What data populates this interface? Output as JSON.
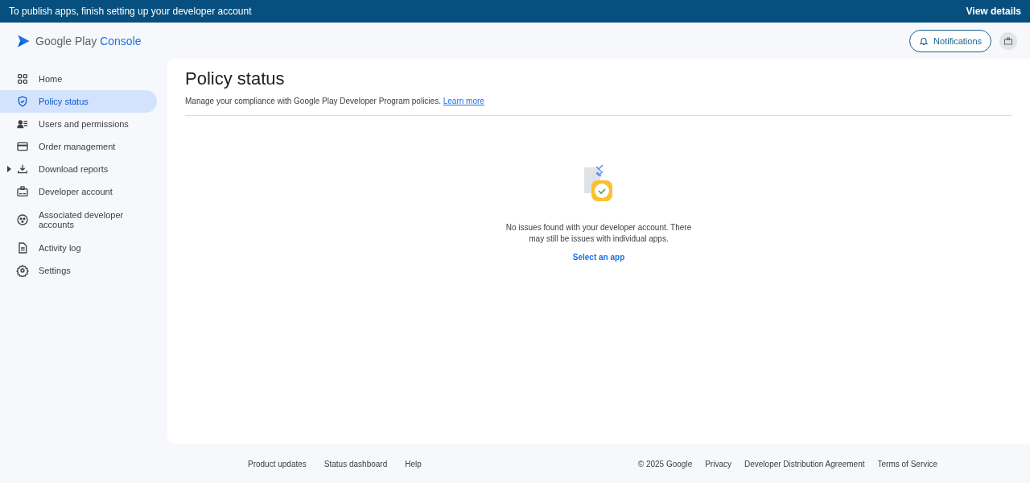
{
  "banner": {
    "message": "To publish apps, finish setting up your developer account",
    "action": "View details"
  },
  "header": {
    "logo_text": "Google Play",
    "logo_accent": "Console",
    "notifications_button": "Notifications"
  },
  "sidebar": {
    "items": [
      {
        "kind": "home",
        "label": "Home",
        "selected": false
      },
      {
        "kind": "policy",
        "label": "Policy status",
        "selected": true
      },
      {
        "kind": "users",
        "label": "Users and permissions",
        "selected": false
      },
      {
        "kind": "order",
        "label": "Order management",
        "selected": false
      },
      {
        "kind": "download",
        "label": "Download reports",
        "selected": false,
        "expanded": false
      },
      {
        "kind": "account",
        "label": "Developer account",
        "selected": false
      },
      {
        "kind": "associated",
        "label": "Associated developer accounts",
        "selected": false
      },
      {
        "kind": "log",
        "label": "Activity log",
        "selected": false
      },
      {
        "kind": "settings",
        "label": "Settings",
        "selected": false
      }
    ]
  },
  "page": {
    "title": "Policy status",
    "subtitle": "Manage your compliance with Google Play Developer Program policies.",
    "subtitle_link": "Learn more",
    "empty_state": {
      "message": "No issues found with your developer account. There may still be issues with individual apps.",
      "action": "Select an app"
    }
  },
  "footer": {
    "left_links": [
      "Product updates",
      "Status dashboard",
      "Help"
    ],
    "copyright": "© 2025 Google",
    "right_links": [
      "Privacy",
      "Developer Distribution Agreement",
      "Terms of Service"
    ]
  }
}
